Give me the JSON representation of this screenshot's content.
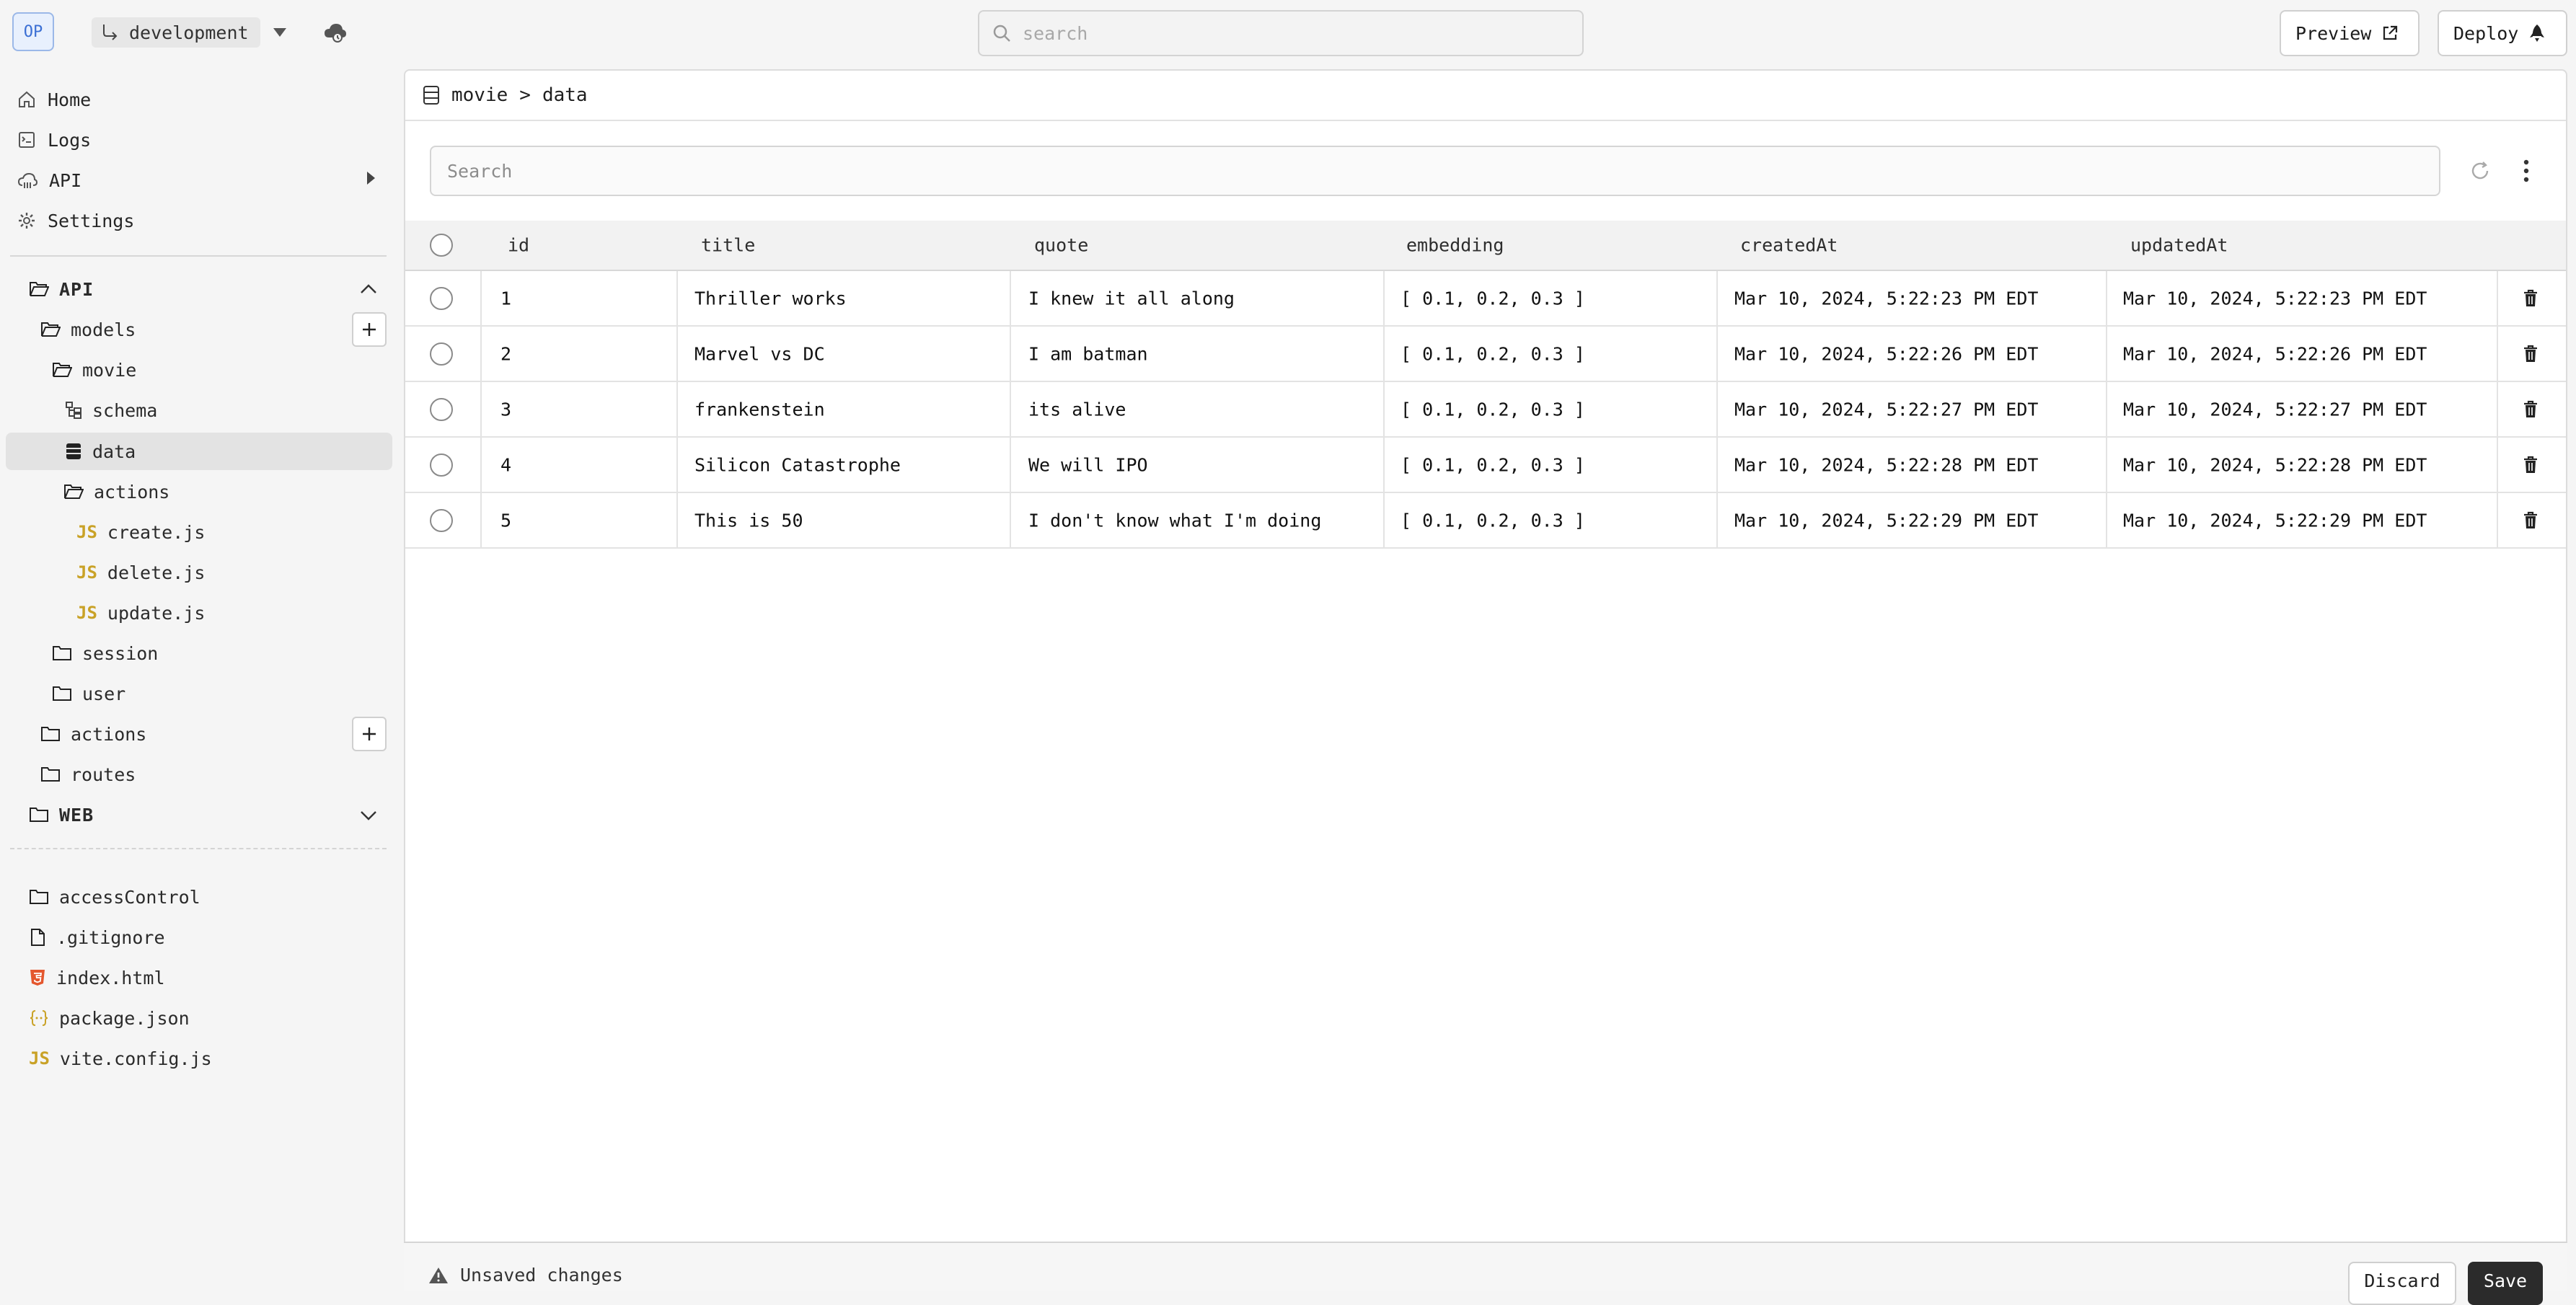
{
  "header": {
    "app_badge": "OP",
    "branch": "development",
    "search_placeholder": "search",
    "preview_label": "Preview",
    "deploy_label": "Deploy"
  },
  "nav": {
    "items": [
      {
        "label": "Home",
        "icon": "home-icon"
      },
      {
        "label": "Logs",
        "icon": "logs-icon"
      },
      {
        "label": "API",
        "icon": "api-icon"
      },
      {
        "label": "Settings",
        "icon": "gear-icon"
      }
    ]
  },
  "tree": {
    "api": "API",
    "models": "models",
    "movie": "movie",
    "schema": "schema",
    "data": "data",
    "actions": "actions",
    "js_badge": "JS",
    "create": "create.js",
    "delete": "delete.js",
    "update": "update.js",
    "session": "session",
    "user": "user",
    "api_actions": "actions",
    "routes": "routes",
    "web": "WEB"
  },
  "files": {
    "access_control": "accessControl",
    "gitignore": ".gitignore",
    "index_html": "index.html",
    "package_json": "package.json",
    "vite_config": "vite.config.js",
    "js_badge": "JS"
  },
  "breadcrumb": {
    "model": "movie",
    "sep": ">",
    "page": "data"
  },
  "table": {
    "search_placeholder": "Search",
    "columns": [
      "id",
      "title",
      "quote",
      "embedding",
      "createdAt",
      "updatedAt"
    ],
    "rows": [
      {
        "id": "1",
        "title": "Thriller works",
        "quote": "I knew it all along",
        "embedding": "[ 0.1, 0.2, 0.3 ]",
        "createdAt": "Mar 10, 2024, 5:22:23 PM EDT",
        "updatedAt": "Mar 10, 2024, 5:22:23 PM EDT"
      },
      {
        "id": "2",
        "title": "Marvel vs DC",
        "quote": "I am batman",
        "embedding": "[ 0.1, 0.2, 0.3 ]",
        "createdAt": "Mar 10, 2024, 5:22:26 PM EDT",
        "updatedAt": "Mar 10, 2024, 5:22:26 PM EDT"
      },
      {
        "id": "3",
        "title": "frankenstein",
        "quote": "its alive",
        "embedding": "[ 0.1, 0.2, 0.3 ]",
        "createdAt": "Mar 10, 2024, 5:22:27 PM EDT",
        "updatedAt": "Mar 10, 2024, 5:22:27 PM EDT"
      },
      {
        "id": "4",
        "title": "Silicon Catastrophe",
        "quote": "We will IPO",
        "embedding": "[ 0.1, 0.2, 0.3 ]",
        "createdAt": "Mar 10, 2024, 5:22:28 PM EDT",
        "updatedAt": "Mar 10, 2024, 5:22:28 PM EDT"
      },
      {
        "id": "5",
        "title": "This is 50",
        "quote": "I don't know what I'm doing",
        "embedding": "[ 0.1, 0.2, 0.3 ]",
        "createdAt": "Mar 10, 2024, 5:22:29 PM EDT",
        "updatedAt": "Mar 10, 2024, 5:22:29 PM EDT"
      }
    ]
  },
  "footer": {
    "status": "Unsaved changes",
    "discard_label": "Discard",
    "save_label": "Save"
  },
  "colors": {
    "accent": "#3b6fd4",
    "js": "#c9a227",
    "html5": "#e4572e",
    "save_bg": "#2b2b2b"
  }
}
